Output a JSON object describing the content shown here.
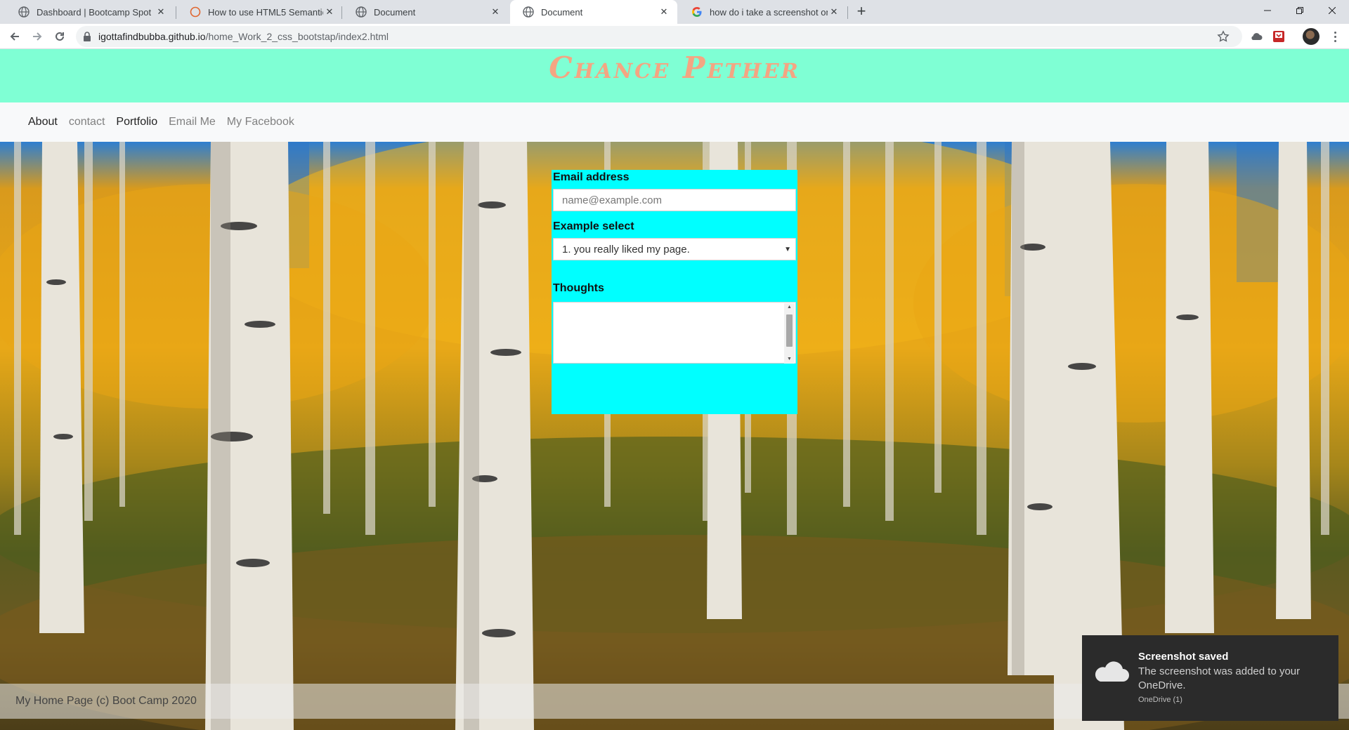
{
  "browser": {
    "tabs": [
      {
        "title": "Dashboard | Bootcamp Spot",
        "icon": "globe-icon"
      },
      {
        "title": "How to use HTML5 Semantic Tag",
        "icon": "circle-icon"
      },
      {
        "title": "Document",
        "icon": "globe-icon"
      },
      {
        "title": "Document",
        "icon": "globe-icon",
        "active": true
      },
      {
        "title": "how do i take a screenshot on a p",
        "icon": "google-icon"
      }
    ],
    "close_glyph": "✕",
    "new_tab_glyph": "+",
    "url_host": "igottafindbubba.github.io",
    "url_path": "/home_Work_2_css_bootstap/index2.html"
  },
  "site": {
    "title": "Chance Pether",
    "nav": [
      {
        "label": "About",
        "style": "dark"
      },
      {
        "label": "contact",
        "style": "muted"
      },
      {
        "label": "Portfolio",
        "style": "dark"
      },
      {
        "label": "Email Me",
        "style": "muted"
      },
      {
        "label": "My Facebook",
        "style": "muted"
      }
    ],
    "form": {
      "email_label": "Email address",
      "email_placeholder": "name@example.com",
      "select_label": "Example select",
      "select_value": "1. you really liked my page.",
      "thoughts_label": "Thoughts",
      "thoughts_value": ""
    },
    "footer": "My Home Page (c) Boot Camp 2020",
    "colors": {
      "header_bg": "#7fffd4",
      "title": "#f4a582",
      "form_bg": "#00ffff"
    }
  },
  "toast": {
    "title": "Screenshot saved",
    "body": "The screenshot was added to your OneDrive.",
    "source": "OneDrive (1)"
  }
}
